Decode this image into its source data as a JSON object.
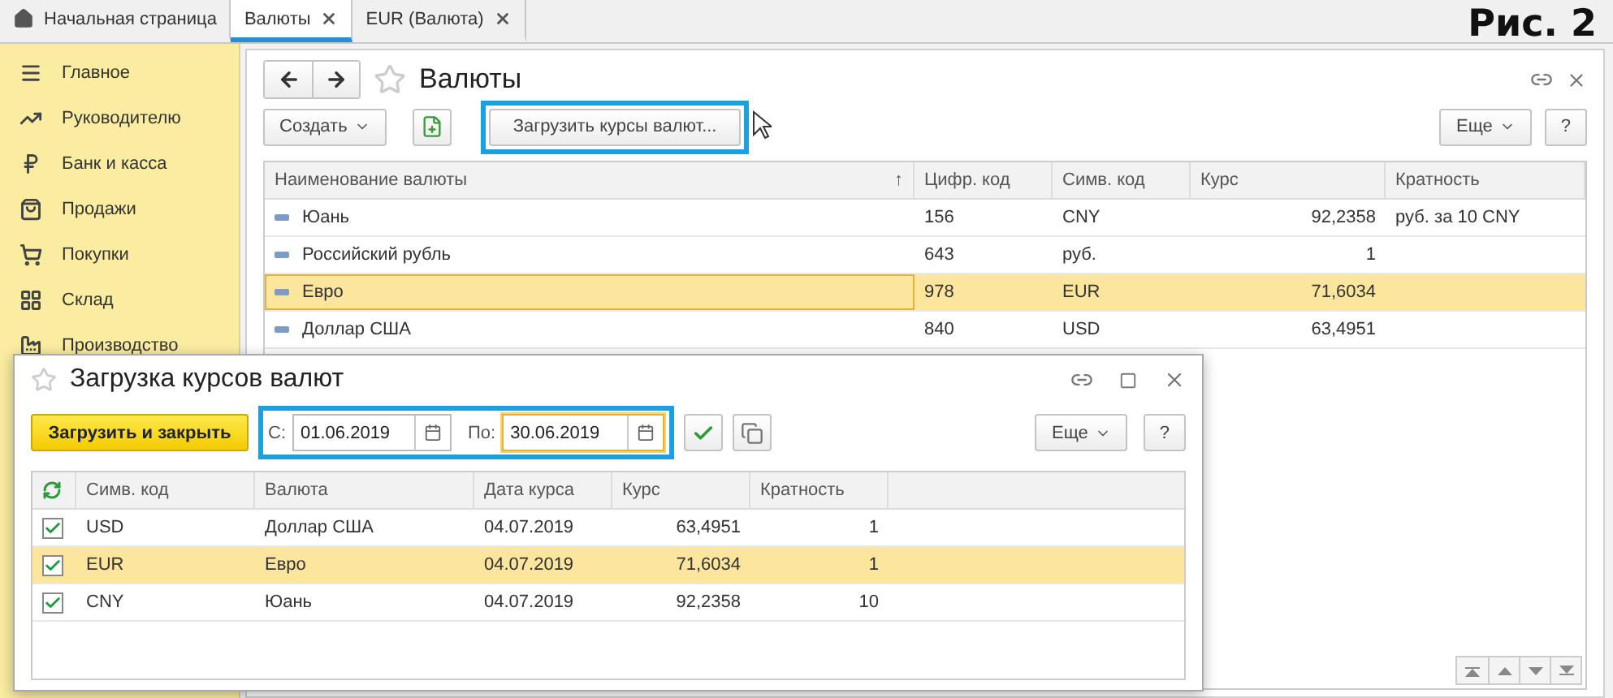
{
  "figure_label": "Рис. 2",
  "tabs": [
    {
      "label": "Начальная страница",
      "kind": "home",
      "selected": false
    },
    {
      "label": "Валюты",
      "kind": "closable",
      "selected": true
    },
    {
      "label": "EUR (Валюта)",
      "kind": "closable",
      "selected": false
    }
  ],
  "sidebar": {
    "items": [
      {
        "label": "Главное",
        "kind": "menu"
      },
      {
        "label": "Руководителю",
        "kind": "trend"
      },
      {
        "label": "Банк и касса",
        "kind": "ruble"
      },
      {
        "label": "Продажи",
        "kind": "bag"
      },
      {
        "label": "Покупки",
        "kind": "cart"
      },
      {
        "label": "Склад",
        "kind": "grid"
      },
      {
        "label": "Производство",
        "kind": "factory"
      }
    ]
  },
  "main_window": {
    "title": "Валюты",
    "toolbar": [
      {
        "kind": "dropdown",
        "label": "Создать"
      },
      {
        "kind": "add-icon"
      },
      {
        "kind": "button",
        "label": "Загрузить курсы валют...",
        "highlighted": true
      }
    ],
    "more_button": "Еще",
    "help_button": "?",
    "table": {
      "columns": [
        {
          "label": "Наименование валюты",
          "sort": "↑"
        },
        {
          "label": "Цифр. код"
        },
        {
          "label": "Симв. код"
        },
        {
          "label": "Курс"
        },
        {
          "label": "Кратность"
        }
      ],
      "rows": [
        {
          "cells": [
            "Юань",
            "156",
            "CNY",
            "92,2358",
            "руб. за 10 CNY"
          ],
          "selected": false
        },
        {
          "cells": [
            "Российский рубль",
            "643",
            "руб.",
            "1",
            ""
          ],
          "selected": false
        },
        {
          "cells": [
            "Евро",
            "978",
            "EUR",
            "71,6034",
            ""
          ],
          "selected": true
        },
        {
          "cells": [
            "Доллар США",
            "840",
            "USD",
            "63,4951",
            ""
          ],
          "selected": false
        }
      ]
    }
  },
  "dialog": {
    "title": "Загрузка курсов валют",
    "primary_button": "Загрузить и закрыть",
    "period": {
      "highlighted": true,
      "fields": [
        {
          "label": "С:",
          "value": "01.06.2019",
          "focused": false
        },
        {
          "label": "По:",
          "value": "30.06.2019",
          "focused": true
        }
      ]
    },
    "more_button": "Еще",
    "help_button": "?",
    "table": {
      "columns": [
        {
          "label": "Симв. код"
        },
        {
          "label": "Валюта"
        },
        {
          "label": "Дата курса"
        },
        {
          "label": "Курс"
        },
        {
          "label": "Кратность"
        }
      ],
      "rows": [
        {
          "checked": true,
          "selected": false,
          "cells": [
            "USD",
            "Доллар США",
            "04.07.2019",
            "63,4951",
            "1"
          ]
        },
        {
          "checked": true,
          "selected": true,
          "cells": [
            "EUR",
            "Евро",
            "04.07.2019",
            "71,6034",
            "1"
          ]
        },
        {
          "checked": true,
          "selected": false,
          "cells": [
            "CNY",
            "Юань",
            "04.07.2019",
            "92,2358",
            "10"
          ]
        }
      ]
    }
  }
}
